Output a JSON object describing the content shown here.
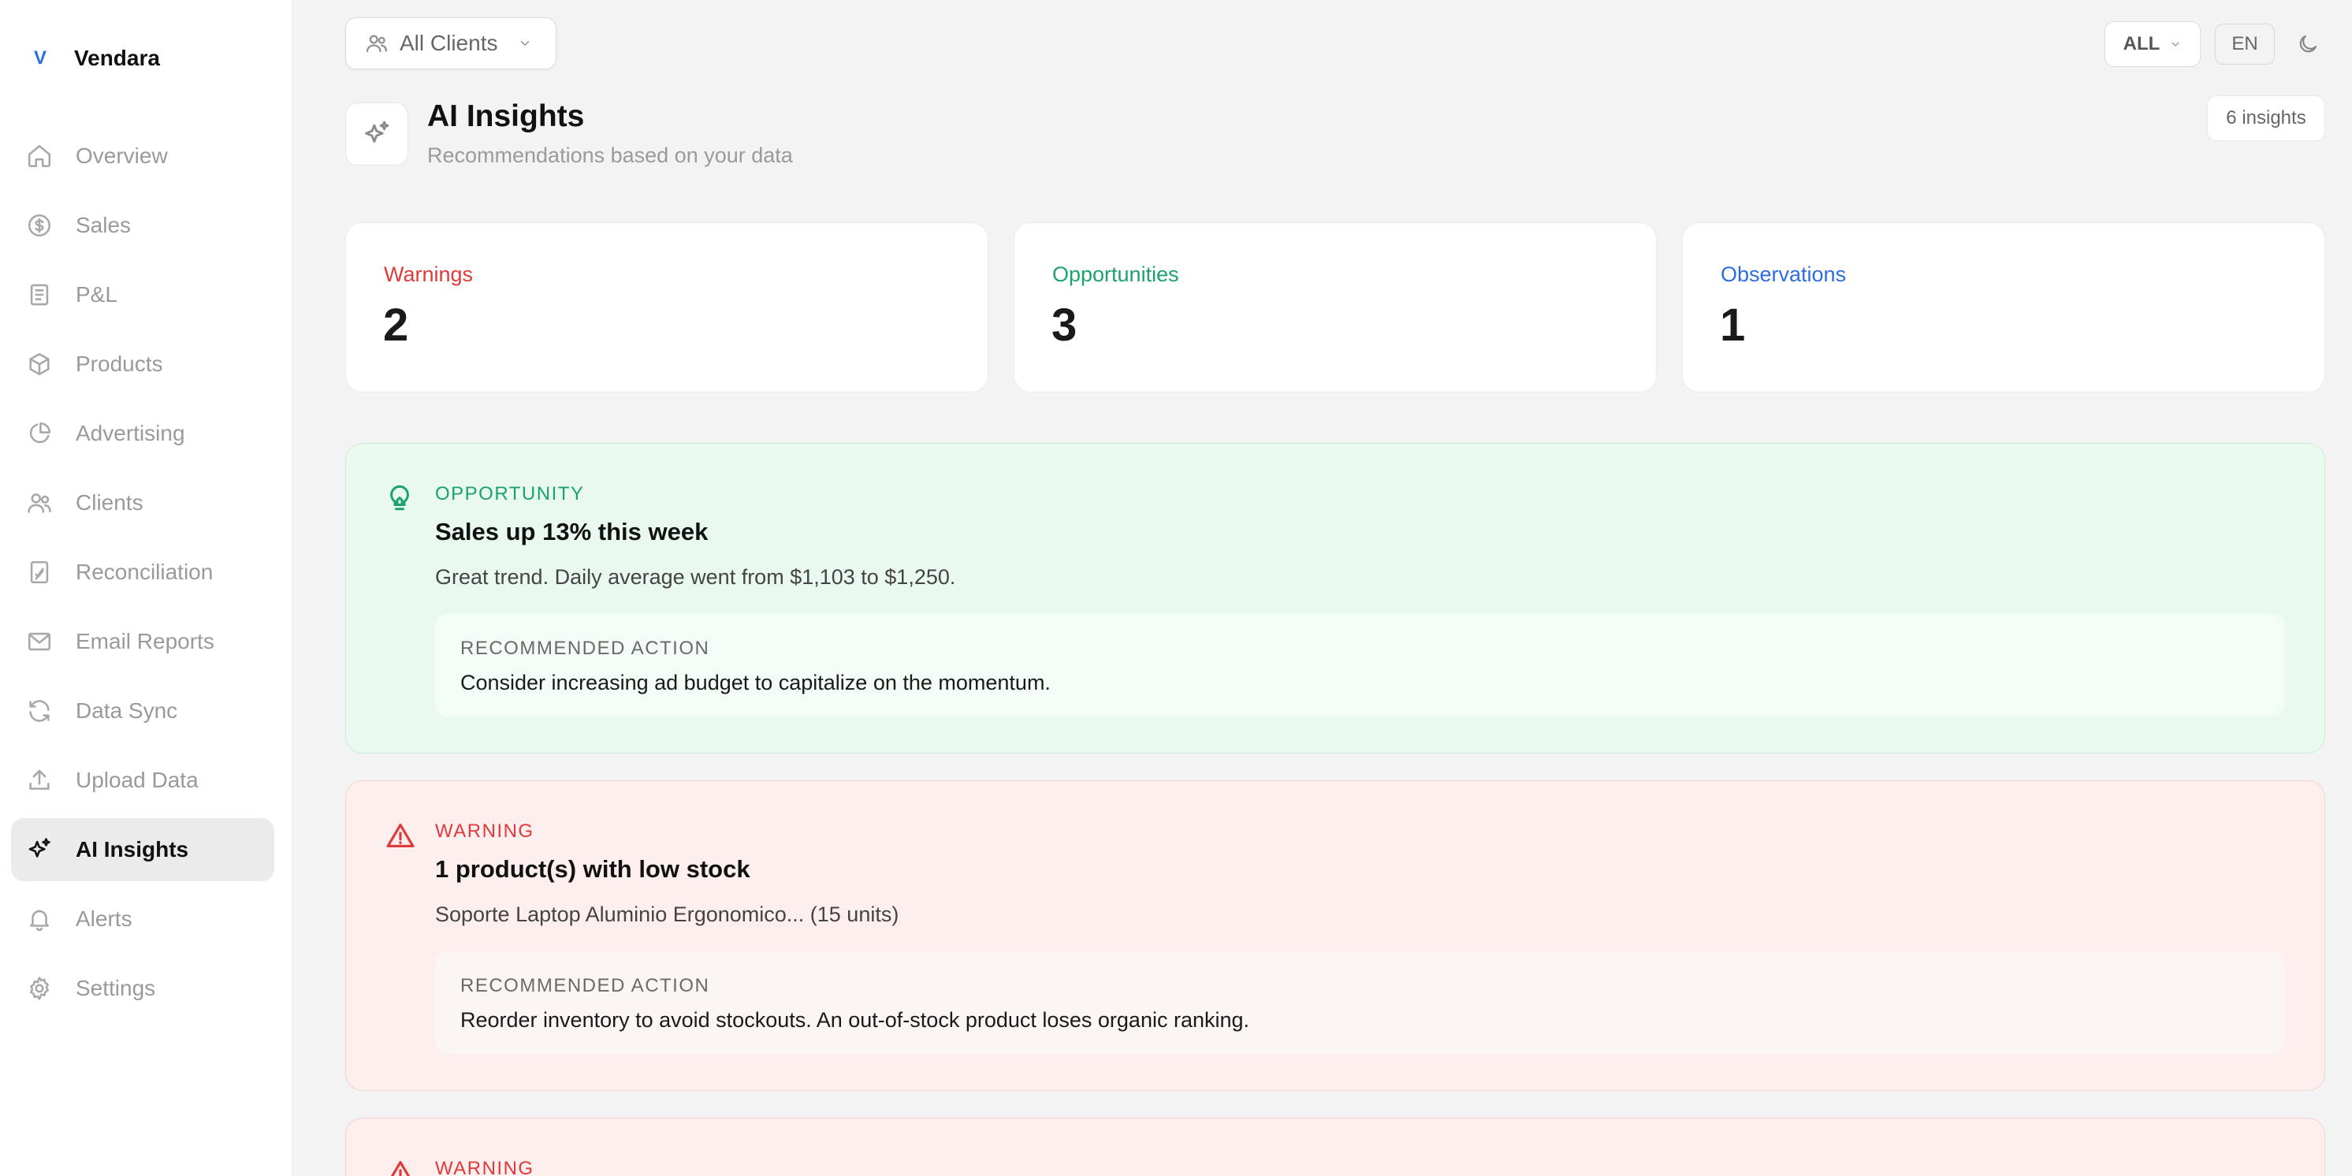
{
  "brand": {
    "mark": "V",
    "name": "Vendara"
  },
  "sidebar": {
    "items": [
      {
        "label": "Overview",
        "icon": "home-icon",
        "active": false
      },
      {
        "label": "Sales",
        "icon": "dollar-circle-icon",
        "active": false
      },
      {
        "label": "P&L",
        "icon": "document-icon",
        "active": false
      },
      {
        "label": "Products",
        "icon": "box-icon",
        "active": false
      },
      {
        "label": "Advertising",
        "icon": "pie-chart-icon",
        "active": false
      },
      {
        "label": "Clients",
        "icon": "users-icon",
        "active": false
      },
      {
        "label": "Reconciliation",
        "icon": "file-check-icon",
        "active": false
      },
      {
        "label": "Email Reports",
        "icon": "mail-icon",
        "active": false
      },
      {
        "label": "Data Sync",
        "icon": "refresh-icon",
        "active": false
      },
      {
        "label": "Upload Data",
        "icon": "upload-icon",
        "active": false
      },
      {
        "label": "AI Insights",
        "icon": "sparkles-icon",
        "active": true
      },
      {
        "label": "Alerts",
        "icon": "bell-icon",
        "active": false
      },
      {
        "label": "Settings",
        "icon": "gear-icon",
        "active": false
      }
    ]
  },
  "topbar": {
    "client_select": "All Clients",
    "period_select": "ALL",
    "language": "EN"
  },
  "header": {
    "title": "AI Insights",
    "subtitle": "Recommendations based on your data",
    "count": "6 insights"
  },
  "stats": [
    {
      "label": "Warnings",
      "value": "2",
      "color": "#e03a3a"
    },
    {
      "label": "Opportunities",
      "value": "3",
      "color": "#1aa36b"
    },
    {
      "label": "Observations",
      "value": "1",
      "color": "#2e6de0"
    }
  ],
  "insights": [
    {
      "kind": "opportunity",
      "type_label": "OPPORTUNITY",
      "icon": "lightbulb-icon",
      "color": "#1aa36b",
      "title": "Sales up 13% this week",
      "description": "Great trend. Daily average went from $1,103 to $1,250.",
      "action_label": "RECOMMENDED ACTION",
      "action_text": "Consider increasing ad budget to capitalize on the momentum."
    },
    {
      "kind": "warning",
      "type_label": "WARNING",
      "icon": "warning-triangle-icon",
      "color": "#e03a3a",
      "title": "1 product(s) with low stock",
      "description": "Soporte Laptop Aluminio Ergonomico... (15 units)",
      "action_label": "RECOMMENDED ACTION",
      "action_text": "Reorder inventory to avoid stockouts. An out-of-stock product loses organic ranking."
    },
    {
      "kind": "warning",
      "type_label": "WARNING",
      "icon": "warning-triangle-icon",
      "color": "#e03a3a"
    }
  ]
}
